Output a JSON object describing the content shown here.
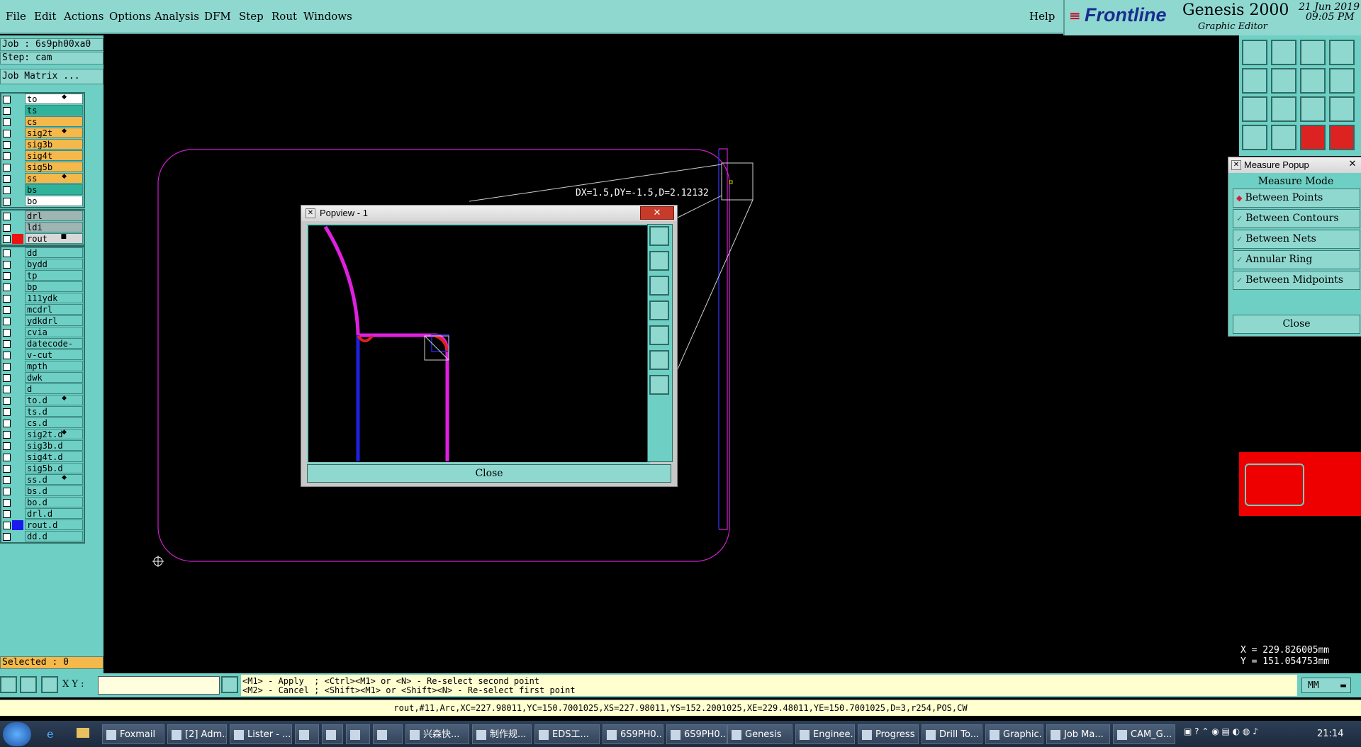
{
  "menu": [
    "File",
    "Edit",
    "Actions",
    "Options",
    "Analysis",
    "DFM",
    "Step",
    "Rout",
    "Windows"
  ],
  "help": "Help",
  "brand": {
    "logo": "Frontline",
    "product": "Genesis 2000",
    "subtitle": "Graphic Editor",
    "date": "21 Jun 2019",
    "time": "09:05 PM"
  },
  "job": {
    "job_label": "Job : 6s9ph00xa0",
    "step_label": "Step: cam",
    "matrix_button": "Job Matrix ..."
  },
  "layers": {
    "board": [
      {
        "name": "to",
        "color": "#ffffff",
        "mark": "◆"
      },
      {
        "name": "ts",
        "color": "#2fb39a",
        "mark": ""
      },
      {
        "name": "cs",
        "color": "#f5b84a",
        "mark": ""
      },
      {
        "name": "sig2t",
        "color": "#f5b84a",
        "mark": "◆"
      },
      {
        "name": "sig3b",
        "color": "#f5b84a",
        "mark": ""
      },
      {
        "name": "sig4t",
        "color": "#f5b84a",
        "mark": ""
      },
      {
        "name": "sig5b",
        "color": "#f5b84a",
        "mark": ""
      },
      {
        "name": "ss",
        "color": "#f5b84a",
        "mark": "◆"
      },
      {
        "name": "bs",
        "color": "#2fb39a",
        "mark": ""
      },
      {
        "name": "bo",
        "color": "#ffffff",
        "mark": ""
      }
    ],
    "drill": [
      {
        "name": "drl",
        "color": "#9fb5b2",
        "mark": ""
      },
      {
        "name": "ldi",
        "color": "#9fb5b2",
        "mark": ""
      },
      {
        "name": "rout",
        "color": "#d8d8d8",
        "mark": "■",
        "active": true
      }
    ],
    "misc": [
      "dd",
      "bydd",
      "tp",
      "bp",
      "111ydk",
      "mcdrl",
      "ydkdrl",
      "cvia",
      "datecode-bo",
      "v-cut",
      "mpth",
      "dwk",
      "d",
      "to.d",
      "ts.d",
      "cs.d",
      "sig2t.d",
      "sig3b.d",
      "sig4t.d",
      "sig5b.d",
      "ss.d",
      "bs.d",
      "bo.d",
      "drl.d",
      "rout.d",
      "dd.d"
    ],
    "misc_marks": {
      "to.d": "◆",
      "sig2t.d": "◆",
      "ss.d": "◆"
    },
    "misc_blue": "rout.d"
  },
  "selected": "Selected : 0",
  "measure_text": "DX=1.5,DY=-1.5,D=2.12132",
  "popview": {
    "title": "Popview - 1",
    "close": "Close"
  },
  "measure_popup": {
    "title": "Measure Popup",
    "header": "Measure Mode",
    "options": [
      "Between Points",
      "Between Contours",
      "Between Nets",
      "Annular Ring",
      "Between Midpoints"
    ],
    "selected": "Between Points",
    "close": "Close"
  },
  "toolbar_icons": [
    "open-icon",
    "save-icon",
    "home-icon",
    "window-icon",
    "arrow-left-icon",
    "arrow-right-icon",
    "swap-icon",
    "s-curve-icon",
    "fit-icon",
    "center-icon",
    "scale-1-2-icon",
    "help-icon",
    "settings-icon",
    "probe-icon",
    "layers-icon",
    "net-icon"
  ],
  "coords": {
    "x": "X = 229.826005mm",
    "y": "Y = 151.054753mm"
  },
  "xy_label": "X Y :",
  "hints": {
    "line1": "<M1> - Apply  ; <Ctrl><M1> or <N> - Re-select second point",
    "line2": "<M2> - Cancel ; <Shift><M1> or <Shift><N> - Re-select first point"
  },
  "units": "MM",
  "feature_info": "rout,#11,Arc,XC=227.98011,YC=150.7001025,XS=227.98011,YS=152.2001025,XE=229.48011,YE=150.7001025,D=3,r254,POS,CW",
  "taskbar": {
    "items": [
      "Foxmail",
      "[2] Adm...",
      "Lister - ...",
      "",
      "",
      "",
      "",
      "兴森快...",
      "制作规...",
      "EDS工...",
      "6S9PH0...",
      "6S9PH0...",
      "Genesis",
      "Enginee...",
      "Progress",
      "Drill To...",
      "Graphic...",
      "Job Ma...",
      "CAM_G..."
    ],
    "clock": "21:14"
  }
}
